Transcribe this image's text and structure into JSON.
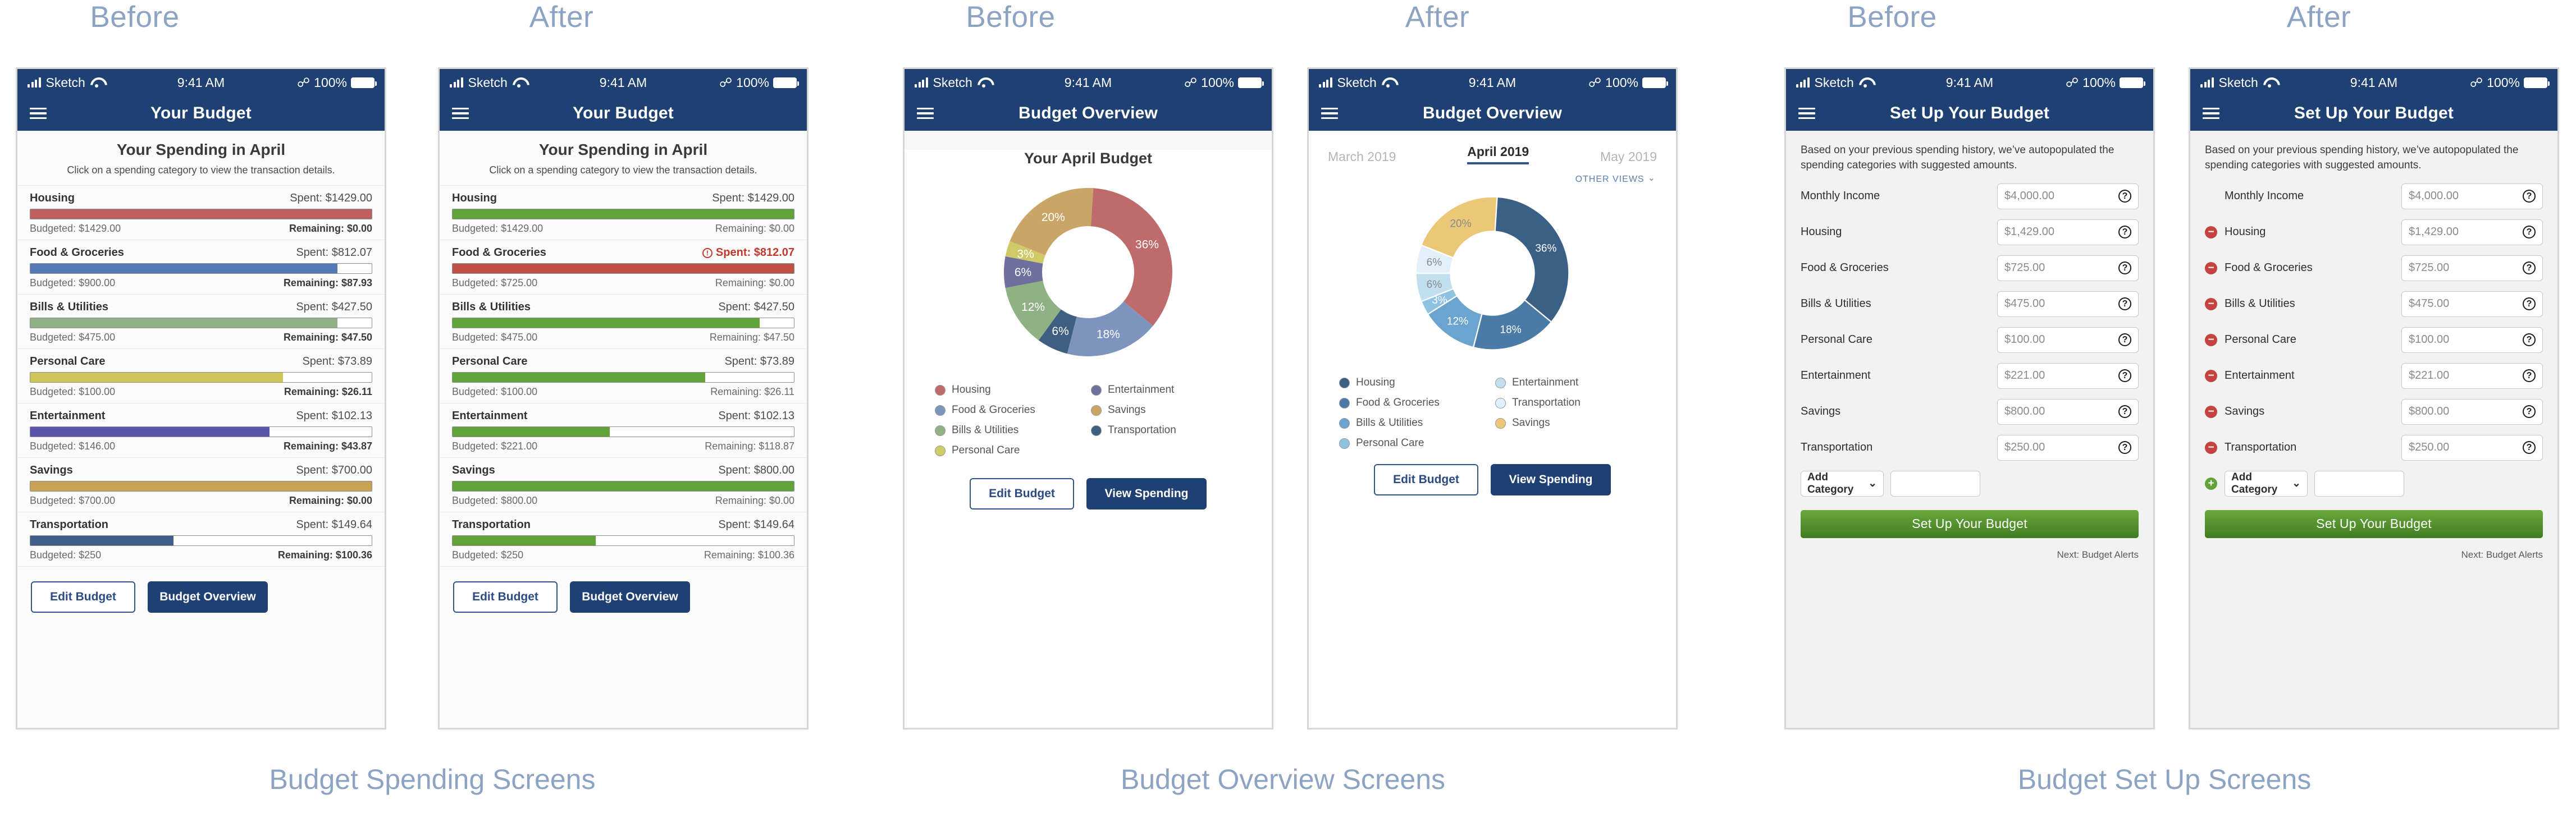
{
  "section_labels": {
    "before": "Before",
    "after": "After"
  },
  "captions": {
    "group1": "Budget Spending Screens",
    "group2": "Budget Overview Screens",
    "group3": "Budget Set Up Screens"
  },
  "statusbar": {
    "carrier": "Sketch",
    "time": "9:41 AM",
    "battery": "100%"
  },
  "colors": {
    "navy": "#1f4073",
    "caption_blue": "#8ca3c4",
    "green": "#61a23b",
    "red": "#c4453e",
    "after_bar_green": "#61a23b",
    "after_bar_red": "#bf5048"
  },
  "spending_before": {
    "nav_title": "Your Budget",
    "heading": "Your Spending in April",
    "subheading": "Click on a spending category to view the transaction details.",
    "categories": [
      {
        "name": "Housing",
        "spent": "Spent: $1429.00",
        "budgeted": "Budgeted: $1429.00",
        "remaining": "Remaining: $0.00",
        "pct": 100,
        "color": "#bf6060",
        "over": false
      },
      {
        "name": "Food & Groceries",
        "spent": "Spent: $812.07",
        "budgeted": "Budgeted: $900.00",
        "remaining": "Remaining: $87.93",
        "pct": 90,
        "color": "#5579b5",
        "over": false
      },
      {
        "name": "Bills & Utilities",
        "spent": "Spent: $427.50",
        "budgeted": "Budgeted: $475.00",
        "remaining": "Remaining: $47.50",
        "pct": 90,
        "color": "#8fb183",
        "over": false
      },
      {
        "name": "Personal Care",
        "spent": "Spent: $73.89",
        "budgeted": "Budgeted: $100.00",
        "remaining": "Remaining: $26.11",
        "pct": 74,
        "color": "#cfc556",
        "over": false
      },
      {
        "name": "Entertainment",
        "spent": "Spent: $102.13",
        "budgeted": "Budgeted: $146.00",
        "remaining": "Remaining: $43.87",
        "pct": 70,
        "color": "#5a55ab",
        "over": false
      },
      {
        "name": "Savings",
        "spent": "Spent: $700.00",
        "budgeted": "Budgeted: $700.00",
        "remaining": "Remaining: $0.00",
        "pct": 100,
        "color": "#c9a155",
        "over": false
      },
      {
        "name": "Transportation",
        "spent": "Spent: $149.64",
        "budgeted": "Budgeted: $250",
        "remaining": "Remaining: $100.36",
        "pct": 42,
        "color": "#3f5f8a",
        "over": false
      }
    ],
    "buttons": {
      "secondary": "Edit Budget",
      "primary": "Budget Overview"
    }
  },
  "spending_after": {
    "nav_title": "Your Budget",
    "heading": "Your Spending in April",
    "subheading": "Click on a spending category to view the transaction details.",
    "categories": [
      {
        "name": "Housing",
        "spent": "Spent: $1429.00",
        "budgeted": "Budgeted: $1429.00",
        "remaining": "Remaining: $0.00",
        "pct": 100,
        "color": "#61a23b",
        "over": false
      },
      {
        "name": "Food & Groceries",
        "spent": "Spent: $812.07",
        "budgeted": "Budgeted: $725.00",
        "remaining": "Remaining: $0.00",
        "pct": 100,
        "color": "#bf5048",
        "over": true
      },
      {
        "name": "Bills & Utilities",
        "spent": "Spent: $427.50",
        "budgeted": "Budgeted: $475.00",
        "remaining": "Remaining: $47.50",
        "pct": 90,
        "color": "#61a23b",
        "over": false
      },
      {
        "name": "Personal Care",
        "spent": "Spent: $73.89",
        "budgeted": "Budgeted: $100.00",
        "remaining": "Remaining: $26.11",
        "pct": 74,
        "color": "#61a23b",
        "over": false
      },
      {
        "name": "Entertainment",
        "spent": "Spent: $102.13",
        "budgeted": "Budgeted: $221.00",
        "remaining": "Remaining: $118.87",
        "pct": 46,
        "color": "#61a23b",
        "over": false
      },
      {
        "name": "Savings",
        "spent": "Spent: $800.00",
        "budgeted": "Budgeted: $800.00",
        "remaining": "Remaining: $0.00",
        "pct": 100,
        "color": "#61a23b",
        "over": false
      },
      {
        "name": "Transportation",
        "spent": "Spent: $149.64",
        "budgeted": "Budgeted: $250",
        "remaining": "Remaining: $100.36",
        "pct": 42,
        "color": "#61a23b",
        "over": false
      }
    ],
    "buttons": {
      "secondary": "Edit Budget",
      "primary": "Budget Overview"
    }
  },
  "overview_before": {
    "nav_title": "Budget Overview",
    "chart_title": "Your April Budget",
    "buttons": {
      "secondary": "Edit Budget",
      "primary": "View Spending"
    }
  },
  "overview_after": {
    "nav_title": "Budget Overview",
    "months": [
      {
        "label": "March 2019",
        "active": false
      },
      {
        "label": "April 2019",
        "active": true
      },
      {
        "label": "May 2019",
        "active": false
      }
    ],
    "other_views": "OTHER VIEWS",
    "buttons": {
      "secondary": "Edit Budget",
      "primary": "View Spending"
    }
  },
  "setup_before": {
    "nav_title": "Set Up Your Budget",
    "intro": "Based on your previous spending history, we’ve autopopulated the spending categories with suggested amounts.",
    "fields": [
      {
        "label": "Monthly Income",
        "value": "$4,000.00",
        "removable": false
      },
      {
        "label": "Housing",
        "value": "$1,429.00",
        "removable": false
      },
      {
        "label": "Food & Groceries",
        "value": "$725.00",
        "removable": false
      },
      {
        "label": "Bills & Utilities",
        "value": "$475.00",
        "removable": false
      },
      {
        "label": "Personal Care",
        "value": "$100.00",
        "removable": false
      },
      {
        "label": "Entertainment",
        "value": "$221.00",
        "removable": false
      },
      {
        "label": "Savings",
        "value": "$800.00",
        "removable": false
      },
      {
        "label": "Transportation",
        "value": "$250.00",
        "removable": false
      }
    ],
    "add_category": "Add Category",
    "submit": "Set Up Your Budget",
    "next": "Next: Budget Alerts"
  },
  "setup_after": {
    "nav_title": "Set Up Your Budget",
    "intro": "Based on your previous spending history, we’ve autopopulated the spending categories with suggested amounts.",
    "fields": [
      {
        "label": "Monthly Income",
        "value": "$4,000.00",
        "removable": false
      },
      {
        "label": "Housing",
        "value": "$1,429.00",
        "removable": true
      },
      {
        "label": "Food & Groceries",
        "value": "$725.00",
        "removable": true
      },
      {
        "label": "Bills & Utilities",
        "value": "$475.00",
        "removable": true
      },
      {
        "label": "Personal Care",
        "value": "$100.00",
        "removable": true
      },
      {
        "label": "Entertainment",
        "value": "$221.00",
        "removable": true
      },
      {
        "label": "Savings",
        "value": "$800.00",
        "removable": true
      },
      {
        "label": "Transportation",
        "value": "$250.00",
        "removable": true
      }
    ],
    "add_category": "Add Category",
    "submit": "Set Up Your Budget",
    "next": "Next: Budget Alerts"
  },
  "chart_data": [
    {
      "type": "pie",
      "variant": "donut",
      "title": "Your April Budget",
      "screen": "overview_before",
      "categories": [
        "Housing",
        "Food & Groceries",
        "Transportation",
        "Bills & Utilities",
        "Entertainment",
        "Personal Care",
        "Savings"
      ],
      "values": [
        36,
        18,
        6,
        12,
        6,
        3,
        20
      ],
      "labels": [
        "36%",
        "18%",
        "6%",
        "12%",
        "6%",
        "3%",
        "20%"
      ],
      "colors": [
        "#bf6b6b",
        "#7d94bf",
        "#3f5f80",
        "#8fb183",
        "#6f6f9e",
        "#cfc968",
        "#c9a668"
      ],
      "legend_order": [
        "Housing",
        "Entertainment",
        "Food & Groceries",
        "Savings",
        "Bills & Utilities",
        "Transportation",
        "Personal Care"
      ],
      "legend_position": "below"
    },
    {
      "type": "pie",
      "variant": "donut",
      "title": "",
      "screen": "overview_after",
      "categories": [
        "Housing",
        "Food & Groceries",
        "Bills & Utilities",
        "Personal Care",
        "Entertainment",
        "Transportation",
        "Savings"
      ],
      "values": [
        36,
        18,
        12,
        3,
        6,
        6,
        20
      ],
      "labels": [
        "36%",
        "18%",
        "12%",
        "3%",
        "6%",
        "6%",
        "20%"
      ],
      "colors": [
        "#3a6085",
        "#497ba6",
        "#6aa4cf",
        "#8fc2e0",
        "#c2dff0",
        "#e1f0fa",
        "#eac878"
      ],
      "legend_order": [
        "Housing",
        "Entertainment",
        "Food & Groceries",
        "Transportation",
        "Bills & Utilities",
        "Savings",
        "Personal Care"
      ],
      "legend_position": "below"
    }
  ],
  "legend_before": [
    {
      "label": "Housing",
      "color": "#bf6b6b"
    },
    {
      "label": "Entertainment",
      "color": "#6f6f9e"
    },
    {
      "label": "Food & Groceries",
      "color": "#7d94bf"
    },
    {
      "label": "Savings",
      "color": "#c9a668"
    },
    {
      "label": "Bills & Utilities",
      "color": "#8fb183"
    },
    {
      "label": "Transportation",
      "color": "#3f5f80"
    },
    {
      "label": "Personal Care",
      "color": "#cfc968"
    }
  ],
  "legend_after": [
    {
      "label": "Housing",
      "color": "#3a6085"
    },
    {
      "label": "Entertainment",
      "color": "#c2dff0"
    },
    {
      "label": "Food & Groceries",
      "color": "#497ba6"
    },
    {
      "label": "Transportation",
      "color": "#e1f0fa"
    },
    {
      "label": "Bills & Utilities",
      "color": "#6aa4cf"
    },
    {
      "label": "Savings",
      "color": "#eac878"
    },
    {
      "label": "Personal Care",
      "color": "#8fc2e0"
    }
  ]
}
